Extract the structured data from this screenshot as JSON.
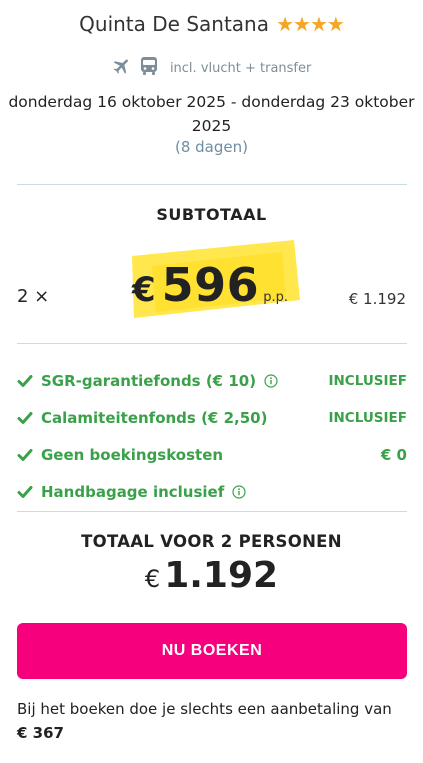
{
  "hotel": {
    "name": "Quinta De Santana",
    "stars": 4
  },
  "transport": {
    "text": "incl. vlucht + transfer",
    "icons": [
      "airplane-icon",
      "bus-icon"
    ]
  },
  "trip": {
    "dates": "donderdag 16 oktober 2025 - donderdag 23 oktober 2025",
    "duration": "(8 dagen)"
  },
  "subtotal": {
    "title": "SUBTOTAAL",
    "quantity": "2 ×",
    "currency": "€",
    "price": "596",
    "per_person": "p.p.",
    "total": "€ 1.192"
  },
  "features": [
    {
      "label": "SGR-garantiefonds  (€ 10)",
      "info": true,
      "value": "INCLUSIEF"
    },
    {
      "label": "Calamiteitenfonds  (€ 2,50)",
      "info": false,
      "value": "INCLUSIEF"
    },
    {
      "label": "Geen boekingskosten",
      "info": false,
      "value": "€ 0"
    },
    {
      "label": "Handbagage inclusief",
      "info": true,
      "value": ""
    }
  ],
  "total": {
    "title": "TOTAAL VOOR 2 PERSONEN",
    "currency": "€",
    "amount": "1.192"
  },
  "book_button": "NU BOEKEN",
  "deposit": {
    "text": "Bij het boeken doe je slechts een aanbetaling van",
    "amount": "€ 367"
  },
  "colors": {
    "accent": "#f7007d",
    "success": "#3aa14a",
    "star": "#f5a623",
    "highlight": "#ffe74d",
    "muted": "#7d8e9a"
  }
}
